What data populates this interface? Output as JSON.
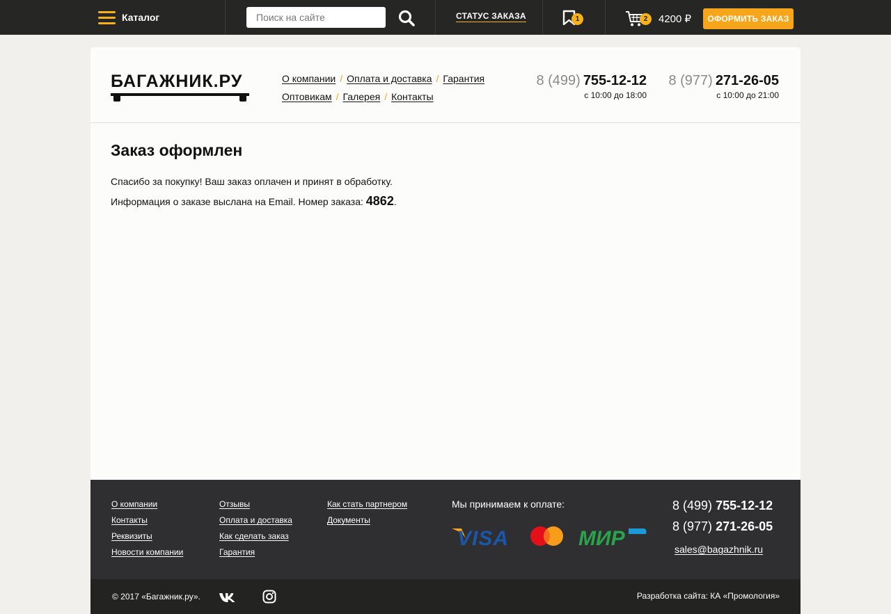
{
  "topbar": {
    "catalog_label": "Каталог",
    "search_placeholder": "Поиск на сайте",
    "order_status_label": "СТАТУС ЗАКАЗА",
    "favorites_count": "1",
    "cart_count": "2",
    "cart_total": "4200 ₽",
    "checkout_label": "ОФОРМИТЬ ЗАКАЗ"
  },
  "header": {
    "logo_text": "БАГАЖНИК.РУ",
    "nav_row1": [
      "О компании",
      "Оплата и доставка",
      "Гарантия"
    ],
    "nav_row2": [
      "Оптовикам",
      "Галерея",
      "Контакты"
    ],
    "phones": [
      {
        "code": "8 (499)",
        "number": "755-12-12",
        "hours": "с 10:00 до 18:00"
      },
      {
        "code": "8 (977)",
        "number": "271-26-05",
        "hours": "с 10:00 до 21:00"
      }
    ]
  },
  "main": {
    "title": "Заказ оформлен",
    "message_line1": "Спасибо за покупку! Ваш заказ оплачен и принят в обработку.",
    "message_line2_prefix": "Информация о заказе выслана на Email. Номер заказа: ",
    "order_number": "4862",
    "message_line2_suffix": "."
  },
  "footer": {
    "col1": [
      "О компании",
      "Контакты",
      "Реквизиты",
      "Новости компании"
    ],
    "col2": [
      "Отзывы",
      "Оплата и доставка",
      "Как сделать заказ",
      "Гарантия"
    ],
    "col3": [
      "Как стать партнером",
      "Документы"
    ],
    "payment_title": "Мы принимаем к оплате:",
    "payment_logos": [
      "VISA",
      "Mastercard",
      "МИР"
    ],
    "phones": [
      {
        "code": "8 (499)",
        "number": "755-12-12"
      },
      {
        "code": "8 (977)",
        "number": "271-26-05"
      }
    ],
    "email": "sales@bagazhnik.ru",
    "copyright": "© 2017 «Багажник.ру».",
    "developer": "Разработка сайта: КА «Промология»"
  },
  "colors": {
    "accent": "#f7a51b",
    "topbar_bg": "#262624",
    "footer_bg": "#2f2f31"
  }
}
